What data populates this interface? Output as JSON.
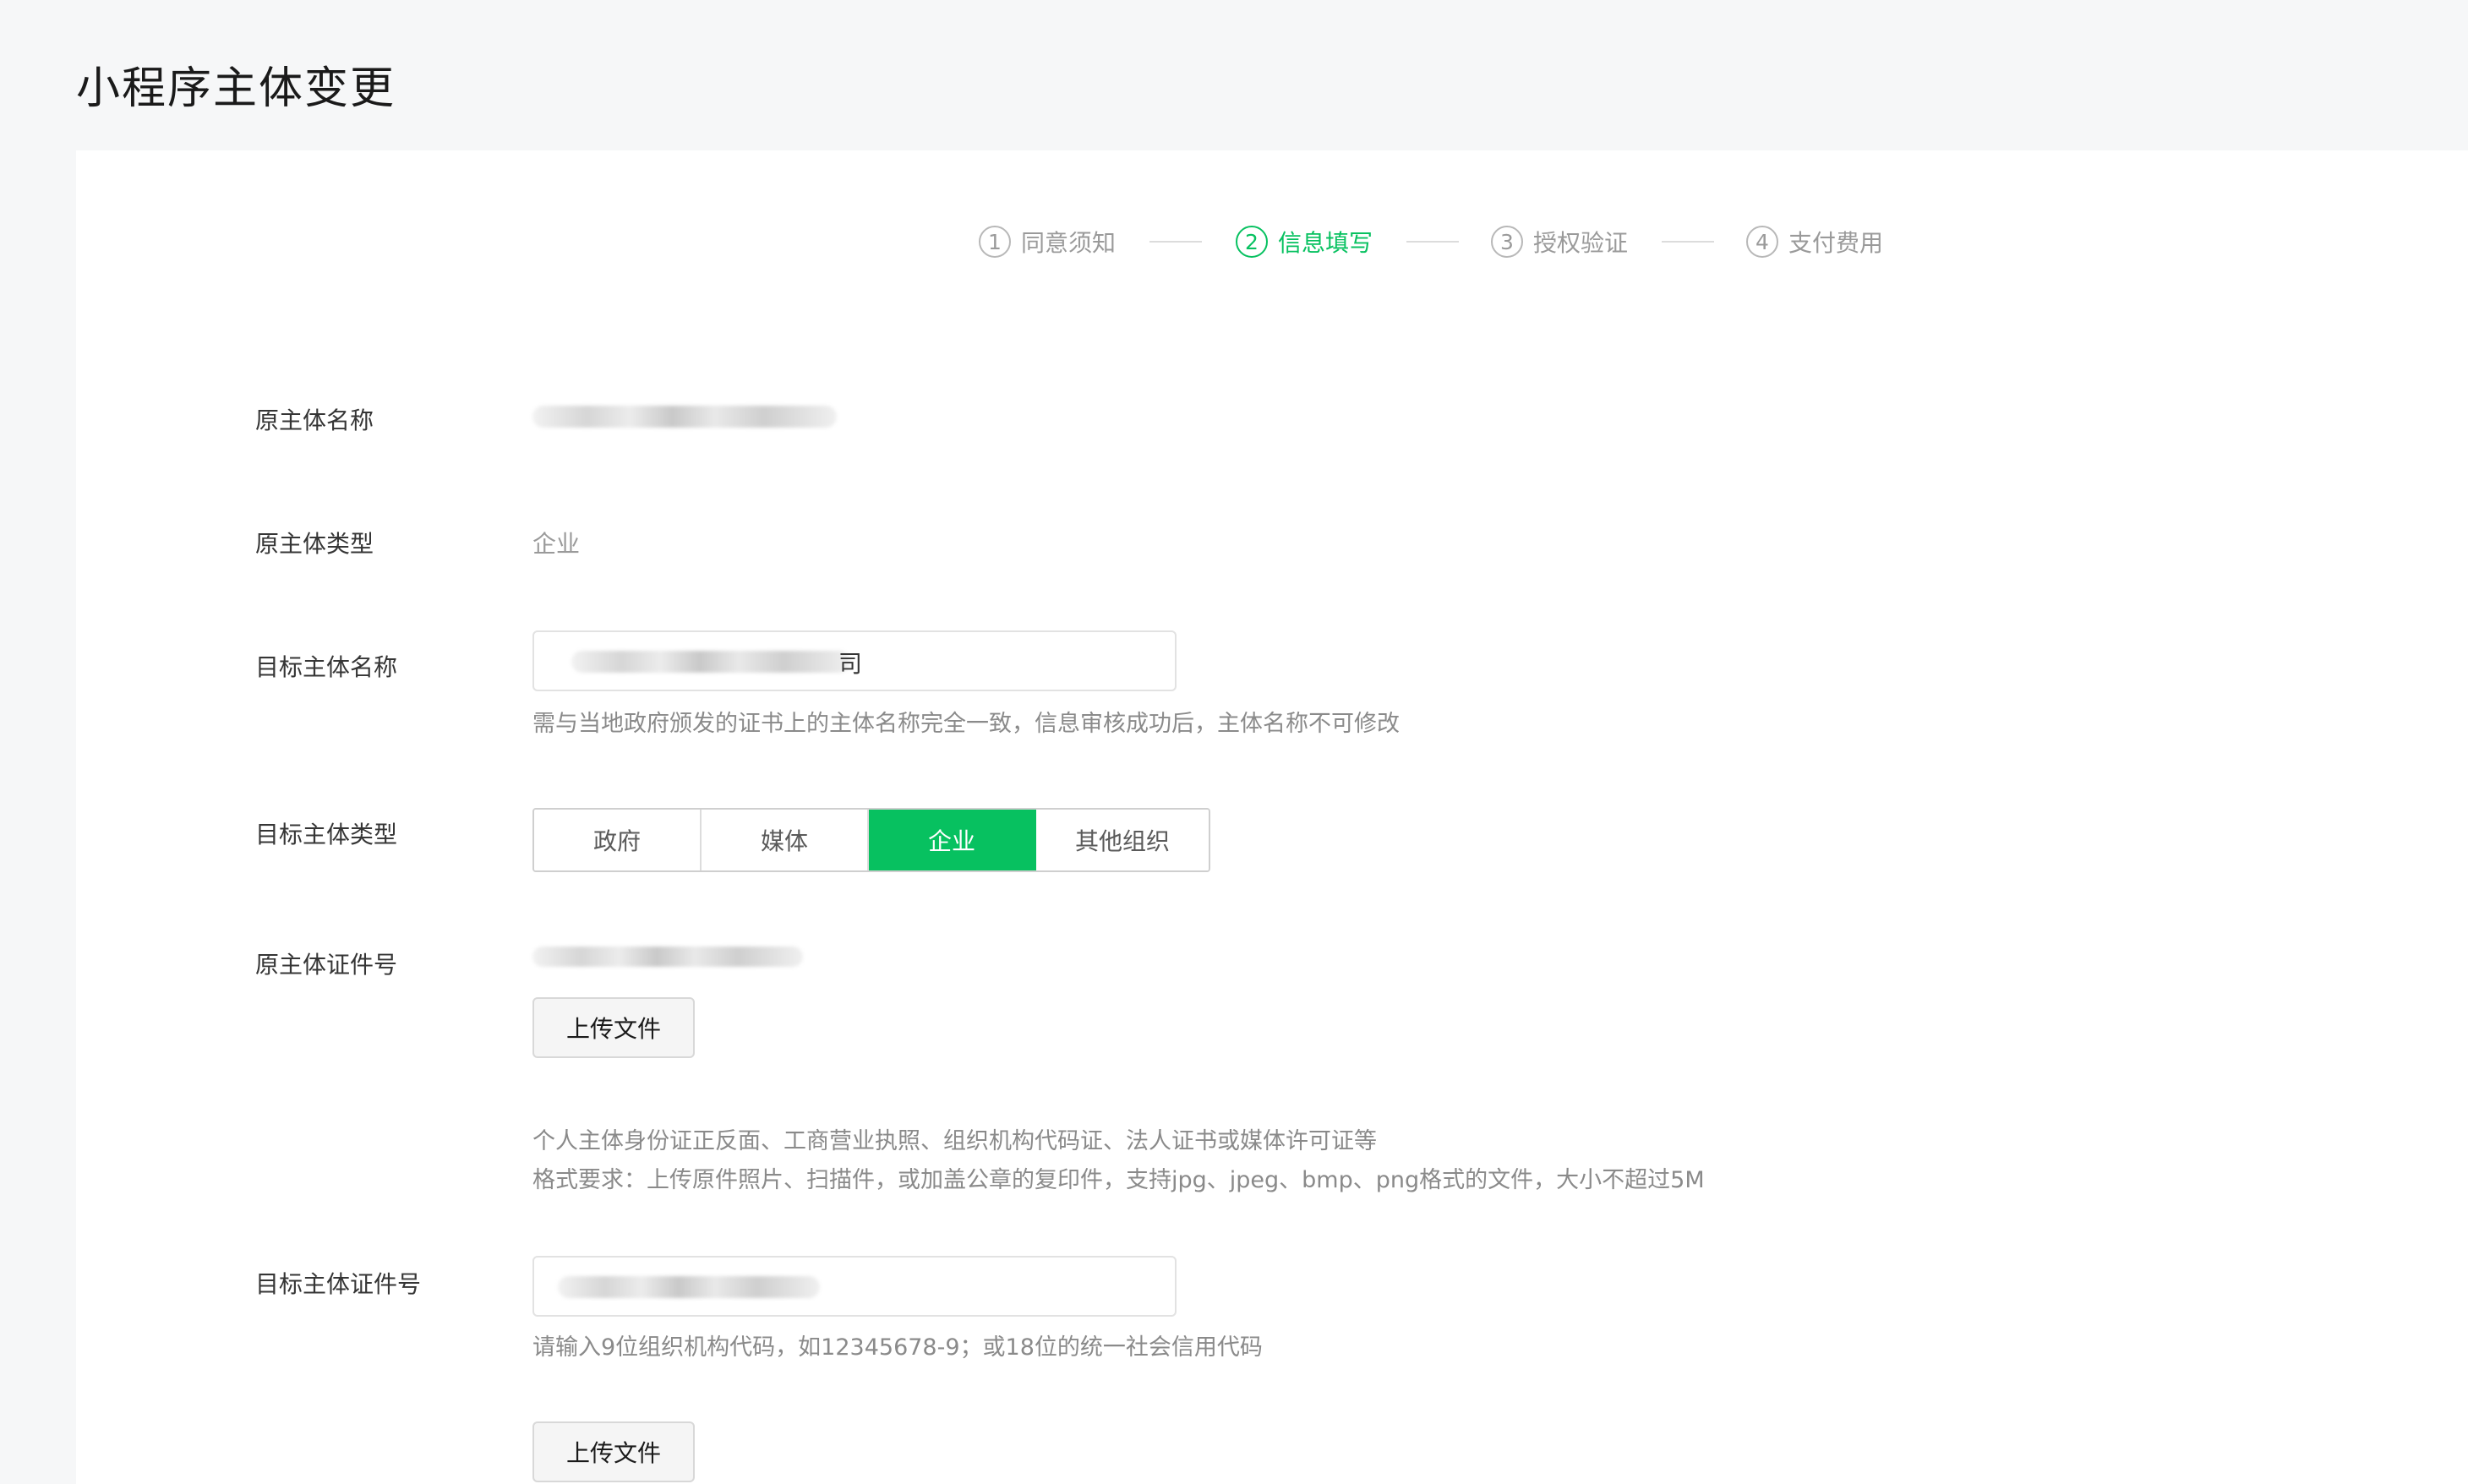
{
  "page": {
    "title": "小程序主体变更"
  },
  "steps": [
    {
      "num": "1",
      "label": "同意须知",
      "active": false
    },
    {
      "num": "2",
      "label": "信息填写",
      "active": true
    },
    {
      "num": "3",
      "label": "授权验证",
      "active": false
    },
    {
      "num": "4",
      "label": "支付费用",
      "active": false
    }
  ],
  "form": {
    "original_name": {
      "label": "原主体名称",
      "value_tail": ""
    },
    "original_type": {
      "label": "原主体类型",
      "value": "企业"
    },
    "target_name": {
      "label": "目标主体名称",
      "value_tail": "司",
      "hint": "需与当地政府颁发的证书上的主体名称完全一致，信息审核成功后，主体名称不可修改"
    },
    "target_type": {
      "label": "目标主体类型",
      "options": [
        "政府",
        "媒体",
        "企业",
        "其他组织"
      ],
      "selected": "企业"
    },
    "original_cert": {
      "label": "原主体证件号",
      "upload_label": "上传文件",
      "hint_line1": "个人主体身份证正反面、工商营业执照、组织机构代码证、法人证书或媒体许可证等",
      "hint_line2": "格式要求：上传原件照片、扫描件，或加盖公章的复印件，支持jpg、jpeg、bmp、png格式的文件，大小不超过5M"
    },
    "target_cert": {
      "label": "目标主体证件号",
      "hint": "请输入9位组织机构代码，如12345678-9；或18位的统一社会信用代码",
      "upload_label": "上传文件"
    }
  },
  "colors": {
    "accent": "#07c160",
    "background": "#f6f7f8",
    "panel": "#ffffff"
  }
}
